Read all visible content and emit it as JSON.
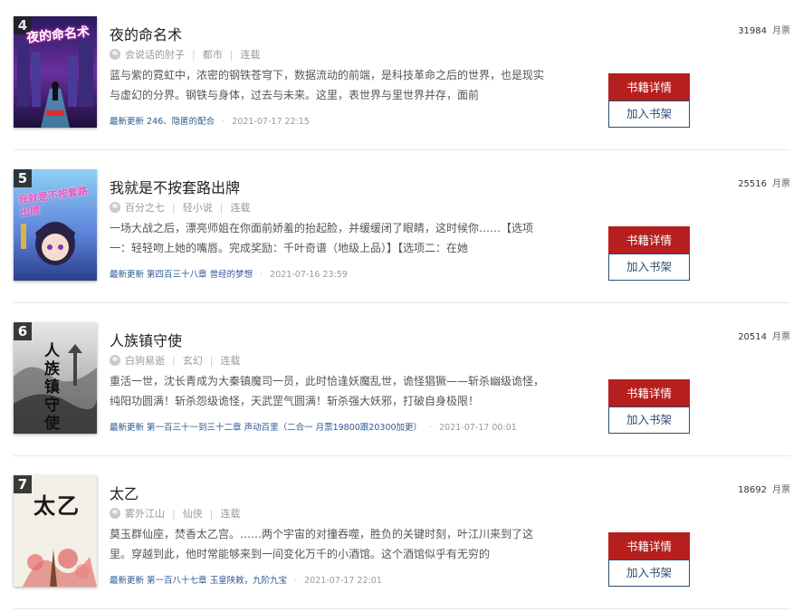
{
  "books": [
    {
      "rank": "4",
      "title": "夜的命名术",
      "author": "会说话的肘子",
      "genre": "都市",
      "status": "连载",
      "description": "蓝与紫的霓虹中，浓密的钢铁苍穹下，数据流动的前端，是科技革命之后的世界，也是现实与虚幻的分界。钢铁与身体，过去与未来。这里，表世界与里世界并存，面前",
      "update_label": "最新更新",
      "update_chapter": "246、隐匿的配合",
      "update_time": "2021-07-17 22:15",
      "votes": "31984",
      "votes_unit": "月票",
      "cover_text": "夜的命名术",
      "detail_label": "书籍详情",
      "shelf_label": "加入书架"
    },
    {
      "rank": "5",
      "title": "我就是不按套路出牌",
      "author": "百分之七",
      "genre": "轻小说",
      "status": "连载",
      "description": "一场大战之后，漂亮师姐在你面前娇羞的抬起脸，并缓缓闭了眼睛，这时候你……【选项一：轻轻吻上她的嘴唇。完成奖励：千叶奇谱（地级上品）】【选项二：在她",
      "update_label": "最新更新",
      "update_chapter": "第四百三十八章 曾经的梦想",
      "update_time": "2021-07-16 23:59",
      "votes": "25516",
      "votes_unit": "月票",
      "cover_text": "我就是不按套路出牌",
      "detail_label": "书籍详情",
      "shelf_label": "加入书架"
    },
    {
      "rank": "6",
      "title": "人族镇守使",
      "author": "白驹易逝",
      "genre": "玄幻",
      "status": "连载",
      "description": "重活一世，沈长青成为大秦镇魔司一员，此时恰逢妖魔乱世，诡怪猖獗——斩杀幽级诡怪，纯阳功圆满！斩杀怨级诡怪，天武罡气圆满！斩杀强大妖邪，打破自身极限！",
      "update_label": "最新更新",
      "update_chapter": "第一百三十一到三十二章 声动百里（二合一 月票19800跟20300加更）",
      "update_time": "2021-07-17 00:01",
      "votes": "20514",
      "votes_unit": "月票",
      "cover_text": "人族镇守使",
      "detail_label": "书籍详情",
      "shelf_label": "加入书架"
    },
    {
      "rank": "7",
      "title": "太乙",
      "author": "雾外江山",
      "genre": "仙侠",
      "status": "连载",
      "description": "莫玉群仙座，焚香太乙宫。……两个宇宙的对撞吞噬，胜负的关键时刻，叶江川来到了这里。穿越到此，他时常能够来到一间变化万千的小酒馆。这个酒馆似乎有无穷的",
      "update_label": "最新更新",
      "update_chapter": "第一百八十七章 玉皇陕敕，九阶九宝",
      "update_time": "2021-07-17 22:01",
      "votes": "18692",
      "votes_unit": "月票",
      "cover_text": "太乙",
      "detail_label": "书籍详情",
      "shelf_label": "加入书架"
    }
  ],
  "colors": {
    "accent_red": "#b5201f",
    "link_blue": "#2c5a92",
    "shelf_border": "#2d4e74"
  }
}
